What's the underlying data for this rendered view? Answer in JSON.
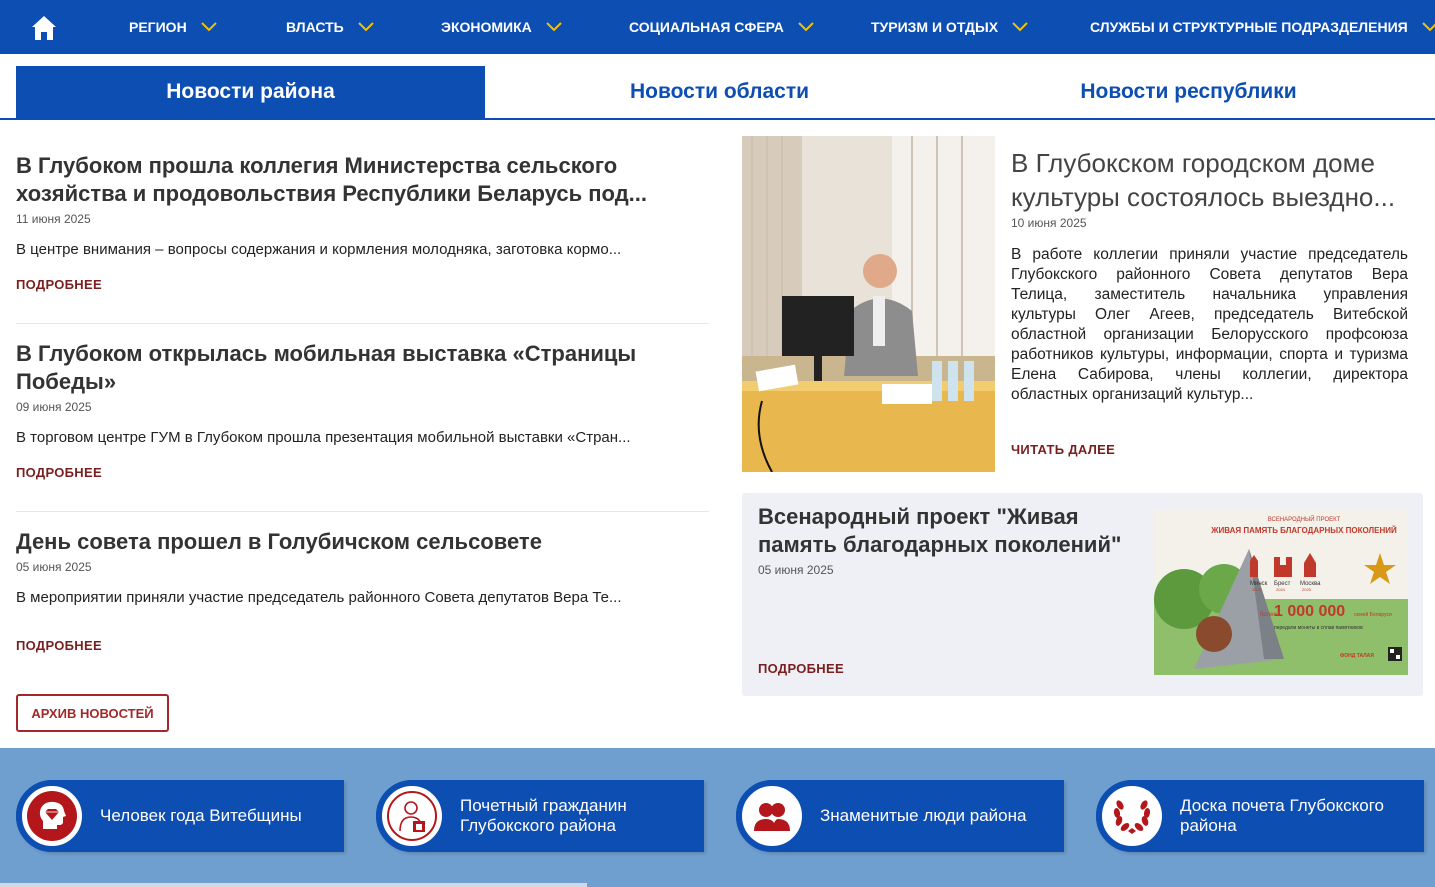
{
  "nav": {
    "items": [
      {
        "label": "РЕГИОН"
      },
      {
        "label": "ВЛАСТЬ"
      },
      {
        "label": "ЭКОНОМИКА"
      },
      {
        "label": "СОЦИАЛЬНАЯ СФЕРА"
      },
      {
        "label": "ТУРИЗМ И ОТДЫХ"
      },
      {
        "label": "СЛУЖБЫ И СТРУКТУРНЫЕ ПОДРАЗДЕЛЕНИЯ"
      }
    ]
  },
  "tabs": [
    {
      "label": "Новости района",
      "active": true
    },
    {
      "label": "Новости области",
      "active": false
    },
    {
      "label": "Новости республики",
      "active": false
    }
  ],
  "news": [
    {
      "title": "В Глубоком прошла коллегия Министерства сельского хозяйства и продовольствия Республики Беларусь под...",
      "date": "11 июня 2025",
      "lead": "В центре внимания – вопросы содержания и кормления молодняка, заготовка кормо...",
      "more": "ПОДРОБНЕЕ"
    },
    {
      "title": "В Глубоком открылась мобильная выставка «Страницы Победы»",
      "date": "09 июня 2025",
      "lead": "В торговом центре ГУМ в Глубоком прошла презентация мобильной выставки «Стран...",
      "more": "ПОДРОБНЕЕ"
    },
    {
      "title": "День совета прошел в Голубичском сельсовете",
      "date": "05 июня 2025",
      "lead": "В мероприятии приняли участие председатель районного Совета депутатов Вера Те...",
      "more": "ПОДРОБНЕЕ"
    }
  ],
  "archive_label": "АРХИВ НОВОСТЕЙ",
  "featured": {
    "title": "В Глубокском городском доме культуры состоялось выездно...",
    "date": "10 июня 2025",
    "text": "В работе коллегии приняли участие председатель Глубокского районного Совета депутатов Вера Телица, заместитель начальника управления культуры Олег Агеев, председатель Витебской областной организации Белорусского профсоюза работников культуры, информации, спорта и туризма Елена Сабирова, члены коллегии, директора областных организаций культур...",
    "more": "ЧИТАТЬ ДАЛЕЕ"
  },
  "project": {
    "title": "Всенародный проект \"Живая память благодарных поколений\"",
    "date": "05 июня 2025",
    "more": "ПОДРОБНЕЕ",
    "poster": {
      "top": "ВСЕНАРОДНЫЙ ПРОЕКТ",
      "heading": "ЖИВАЯ ПАМЯТЬ БЛАГОДАРНЫХ ПОКОЛЕНИЙ",
      "cities": [
        "Минск",
        "Брест",
        "Москва"
      ],
      "years": [
        "2023",
        "2024",
        "2025"
      ],
      "prefix": "более",
      "number": "1 000 000",
      "number_suffix": "семей Беларуси",
      "caption": "передали монеты в сплав памятников",
      "fund": "ФОНД ТАЛАЯ"
    }
  },
  "cards": [
    {
      "label": "Человек года Витебщины",
      "icon": "head-diamond-icon"
    },
    {
      "label": "Почетный гражданин Глубокского района",
      "icon": "honorary-citizen-icon"
    },
    {
      "label": "Знаменитые люди района",
      "icon": "people-icon"
    },
    {
      "label": "Доска почета Глубокского района",
      "icon": "laurel-wreath-icon"
    }
  ],
  "colors": {
    "primary": "#0d4eb3",
    "accent_red": "#a3282a",
    "band": "#6f9fcf",
    "more_link": "#7a1f1f"
  }
}
